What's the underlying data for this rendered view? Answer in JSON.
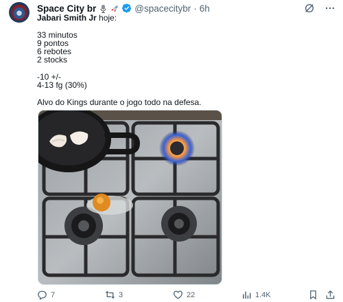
{
  "author": {
    "display_name": "Space City br",
    "handle": "@spacecitybr",
    "separator": "·",
    "time": "6h",
    "emojis": [
      "microphone-emoji",
      "rocket-emoji"
    ],
    "verified": true
  },
  "post": {
    "subject": "Jabari Smith Jr",
    "subject_suffix": " hoje:",
    "stats": "33 minutos\n9 pontos\n6 rebotes\n2 stocks",
    "efficiency": "-10 +/-\n4-13 fg (30%)",
    "comment": "Alvo do Kings durante o jogo todo na defesa.",
    "media_description": "stove-with-frying-pan-and-egg"
  },
  "actions": {
    "replies": "7",
    "reposts": "3",
    "likes": "22",
    "views": "1.4K"
  },
  "colors": {
    "text_primary": "#0f1419",
    "text_secondary": "#536471",
    "verified_blue": "#1d9bf0"
  }
}
